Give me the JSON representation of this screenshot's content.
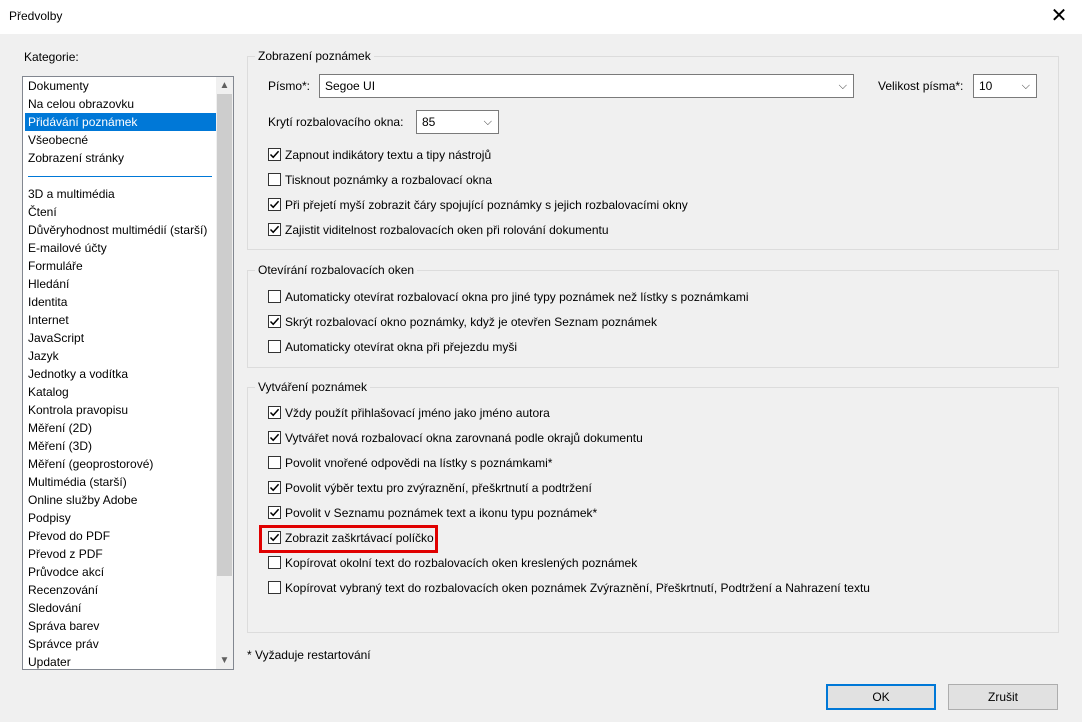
{
  "window": {
    "title": "Předvolby",
    "close_glyph": "✕"
  },
  "categories": {
    "label": "Kategorie:",
    "group1": [
      "Dokumenty",
      "Na celou obrazovku",
      "Přidávání poznámek",
      "Všeobecné",
      "Zobrazení stránky"
    ],
    "group2": [
      "3D a multimédia",
      "Čtení",
      "Důvěryhodnost multimédií (starší)",
      "E-mailové účty",
      "Formuláře",
      "Hledání",
      "Identita",
      "Internet",
      "JavaScript",
      "Jazyk",
      "Jednotky a vodítka",
      "Katalog",
      "Kontrola pravopisu",
      "Měření (2D)",
      "Měření (3D)",
      "Měření (geoprostorové)",
      "Multimédia (starší)",
      "Online služby Adobe",
      "Podpisy",
      "Převod do PDF",
      "Převod z PDF",
      "Průvodce akcí",
      "Recenzování",
      "Sledování",
      "Správa barev",
      "Správce práv",
      "Updater"
    ],
    "selected": "Přidávání poznámek"
  },
  "annotation_display": {
    "title": "Zobrazení poznámek",
    "font_label": "Písmo*:",
    "font_value": "Segoe UI",
    "font_size_label": "Velikost písma*:",
    "font_size_value": "10",
    "opacity_label": "Krytí rozbalovacího okna:",
    "opacity_value": "85",
    "checkboxes": [
      {
        "label": "Zapnout indikátory textu a tipy nástrojů",
        "checked": true
      },
      {
        "label": "Tisknout poznámky a rozbalovací okna",
        "checked": false
      },
      {
        "label": "Při přejetí myší zobrazit čáry spojující poznámky s jejich rozbalovacími okny",
        "checked": true
      },
      {
        "label": "Zajistit viditelnost rozbalovacích oken při rolování dokumentu",
        "checked": true
      }
    ]
  },
  "popup_opening": {
    "title": "Otevírání rozbalovacích oken",
    "checkboxes": [
      {
        "label": "Automaticky otevírat rozbalovací okna pro jiné typy poznámek než lístky s poznámkami",
        "checked": false
      },
      {
        "label": "Skrýt rozbalovací okno poznámky, když je otevřen Seznam poznámek",
        "checked": true
      },
      {
        "label": "Automaticky otevírat okna při přejezdu myši",
        "checked": false
      }
    ]
  },
  "annotation_creation": {
    "title": "Vytváření poznámek",
    "checkboxes": [
      {
        "label": "Vždy použít přihlašovací jméno jako jméno autora",
        "checked": true
      },
      {
        "label": "Vytvářet nová rozbalovací okna zarovnaná podle okrajů dokumentu",
        "checked": true
      },
      {
        "label": "Povolit vnořené odpovědi na lístky s poznámkami*",
        "checked": false
      },
      {
        "label": "Povolit výběr textu pro zvýraznění, přeškrtnutí a podtržení",
        "checked": true
      },
      {
        "label": "Povolit v Seznamu poznámek text a ikonu typu poznámek*",
        "checked": true
      },
      {
        "label": "Zobrazit zaškrtávací políčko",
        "checked": true
      },
      {
        "label": "Kopírovat okolní text do rozbalovacích oken kreslených poznámek",
        "checked": false
      },
      {
        "label": "Kopírovat vybraný text do rozbalovacích oken poznámek Zvýraznění, Přeškrtnutí, Podtržení a Nahrazení textu",
        "checked": false
      }
    ]
  },
  "footer": {
    "restart_note": "* Vyžaduje restartování",
    "ok": "OK",
    "cancel": "Zrušit"
  },
  "colors": {
    "selection": "#0078d7",
    "highlight_border": "#e00000"
  }
}
